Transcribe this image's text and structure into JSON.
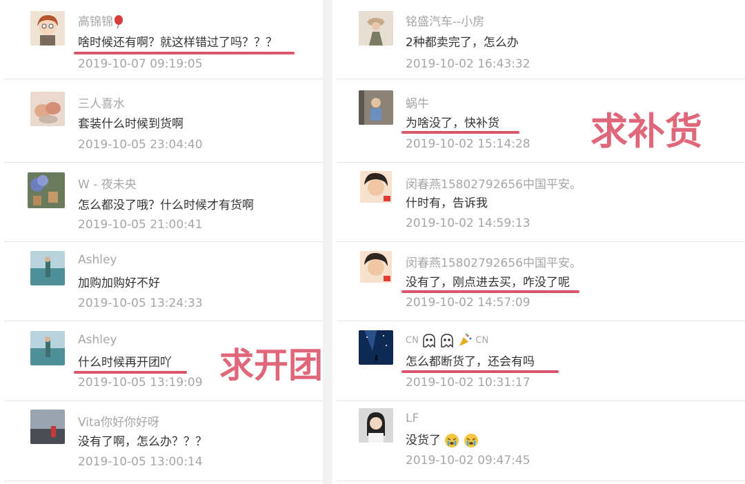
{
  "left_comments": [
    {
      "name": "高锦锦",
      "text": "啥时候还有啊？就这样错过了吗？？？",
      "time": "2019-10-07 09:19:05",
      "name_icon": "balloon-icon"
    },
    {
      "name": "三人喜水",
      "text": "套装什么时候到货啊",
      "time": "2019-10-05 23:04:40"
    },
    {
      "name": "W - 夜未央",
      "text": "怎么都没了哦？什么时候才有货啊",
      "time": "2019-10-05 21:00:41"
    },
    {
      "name": "Ashley",
      "text": "加购加购好不好",
      "time": "2019-10-05 13:24:33"
    },
    {
      "name": "Ashley",
      "text": "什么时候再开团吖",
      "time": "2019-10-05 13:19:09"
    },
    {
      "name": "Vita你好你好呀",
      "text": "没有了啊，怎么办？？？",
      "time": "2019-10-05 13:00:14"
    }
  ],
  "right_comments": [
    {
      "name": "铭盛汽车--小房",
      "text": "2种都卖完了，怎么办",
      "time": "2019-10-02 16:43:32"
    },
    {
      "name": "蜗牛",
      "text": "为啥没了，快补货",
      "time": "2019-10-02 15:14:28"
    },
    {
      "name": "闵春燕15802792656中国平安。",
      "text": "什时有，告诉我",
      "time": "2019-10-02 14:59:13"
    },
    {
      "name": "闵春燕15802792656中国平安。",
      "text": "没有了，刚点进去买，咋没了呢",
      "time": "2019-10-02 14:57:09"
    },
    {
      "name_parts": [
        "CN",
        "CN"
      ],
      "name_icons": [
        "ghost-icon",
        "ghost-icon",
        "party-popper-icon"
      ],
      "text": "怎么都断货了，还会有吗",
      "time": "2019-10-02 10:31:17"
    },
    {
      "name": "LF",
      "text": "没货了",
      "text_icons": [
        "crying-face-icon",
        "crying-face-icon"
      ],
      "time": "2019-10-02 09:47:45"
    }
  ],
  "annotations": {
    "restock": "求补货",
    "reopen_group": "求开团"
  },
  "colors": {
    "annotation": "#e0667a",
    "underline": "#d9566a",
    "meta_text": "#a6a6a6",
    "body_text": "#333333",
    "divider": "#e6e6e6"
  }
}
